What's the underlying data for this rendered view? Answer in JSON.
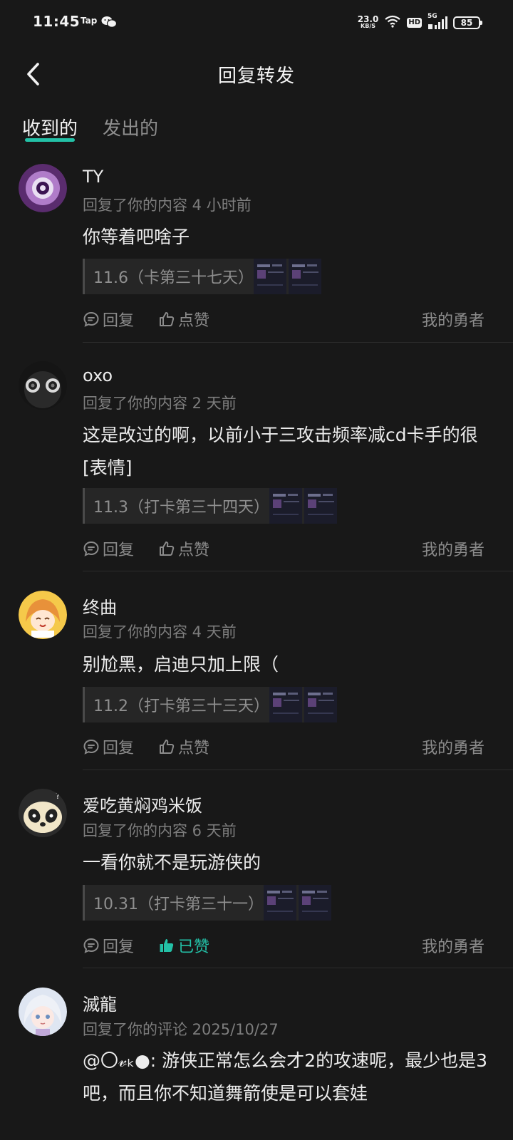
{
  "status": {
    "time": "11:45",
    "app_icons": [
      "Tap",
      "wechat-icon"
    ],
    "net_speed_value": "23.0",
    "net_speed_unit": "KB/S",
    "hd_label": "HD",
    "signal_label": "5G",
    "battery": "85"
  },
  "header": {
    "title": "回复转发",
    "back_icon": "chevron-left-icon"
  },
  "tabs": [
    {
      "label": "收到的",
      "active": true
    },
    {
      "label": "发出的",
      "active": false
    }
  ],
  "colors": {
    "background": "#181818",
    "accent": "#23c1a7",
    "muted": "#7d7d7d"
  },
  "items": [
    {
      "name": "TY",
      "meta": "回复了你的内容 4 小时前",
      "text": "你等着吧啥子",
      "ref": "11.6（卡第三十七天）",
      "reply": "回复",
      "like": "点赞",
      "liked": false,
      "source": "我的勇者"
    },
    {
      "name": "oxo",
      "meta": "回复了你的内容 2 天前",
      "text": "这是改过的啊，以前小于三攻击频率减cd卡手的很[表情]",
      "ref": "11.3（打卡第三十四天）",
      "reply": "回复",
      "like": "点赞",
      "liked": false,
      "source": "我的勇者"
    },
    {
      "name": "终曲",
      "meta": "回复了你的内容 4 天前",
      "text": "别尬黑，启迪只加上限（",
      "ref": "11.2（打卡第三十三天）",
      "reply": "回复",
      "like": "点赞",
      "liked": false,
      "source": "我的勇者"
    },
    {
      "name": "爱吃黄焖鸡米饭",
      "meta": "回复了你的内容 6 天前",
      "text": "一看你就不是玩游侠的",
      "ref": "10.31（打卡第三十一）",
      "reply": "回复",
      "like": "已赞",
      "liked": true,
      "source": "我的勇者"
    },
    {
      "name": "滅龍",
      "meta": "回复了你的评论 2025/10/27",
      "text": "@〇𝓋ₖ●: 游侠正常怎么会才2的攻速呢，最少也是3吧，而且你不知道舞箭使是可以套娃"
    }
  ]
}
